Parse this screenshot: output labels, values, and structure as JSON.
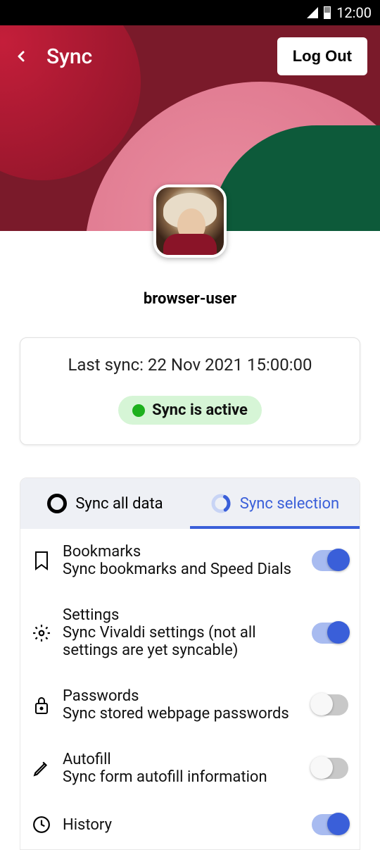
{
  "status_bar": {
    "time": "12:00"
  },
  "header": {
    "title": "Sync",
    "logout_label": "Log Out"
  },
  "profile": {
    "username": "browser-user"
  },
  "sync_status": {
    "last_sync_text": "Last sync: 22 Nov 2021 15:00:00",
    "active_label": "Sync is active"
  },
  "tabs": {
    "all": "Sync all data",
    "selection": "Sync selection"
  },
  "items": [
    {
      "title": "Bookmarks",
      "subtitle": "Sync bookmarks and Speed Dials",
      "enabled": true
    },
    {
      "title": "Settings",
      "subtitle": "Sync Vivaldi settings (not all settings are yet syncable)",
      "enabled": true
    },
    {
      "title": "Passwords",
      "subtitle": "Sync stored webpage passwords",
      "enabled": false
    },
    {
      "title": "Autofill",
      "subtitle": "Sync form autofill information",
      "enabled": false
    },
    {
      "title": "History",
      "subtitle": "",
      "enabled": true
    }
  ]
}
